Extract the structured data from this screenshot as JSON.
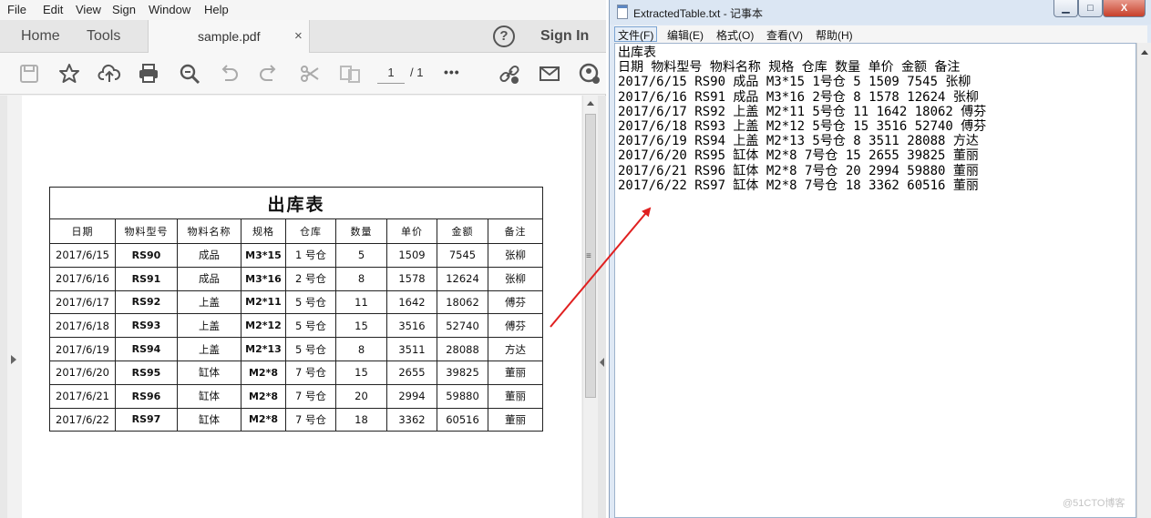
{
  "pdf_viewer": {
    "menu": [
      "File",
      "Edit",
      "View",
      "Sign",
      "Window",
      "Help"
    ],
    "tabs": {
      "home": "Home",
      "tools": "Tools"
    },
    "document_tab": {
      "name": "sample.pdf",
      "close": "×"
    },
    "help": "?",
    "sign_in": "Sign In",
    "toolbar": {
      "icons": [
        "save-icon",
        "star-icon",
        "upload-icon",
        "print-icon",
        "zoom-icon",
        "undo-icon",
        "redo-icon",
        "scissors-icon",
        "compare-icon",
        "more-icon",
        "share-link-icon",
        "mail-icon",
        "add-user-icon"
      ],
      "page_current": "1",
      "page_total": "/ 1",
      "more": "•••"
    },
    "table": {
      "title": "出库表",
      "headers": [
        "日期",
        "物料型号",
        "物料名称",
        "规格",
        "仓库",
        "数量",
        "单价",
        "金额",
        "备注"
      ],
      "rows": [
        [
          "2017/6/15",
          "RS90",
          "成品",
          "M3*15",
          "1 号仓",
          "5",
          "1509",
          "7545",
          "张柳"
        ],
        [
          "2017/6/16",
          "RS91",
          "成品",
          "M3*16",
          "2 号仓",
          "8",
          "1578",
          "12624",
          "张柳"
        ],
        [
          "2017/6/17",
          "RS92",
          "上盖",
          "M2*11",
          "5 号仓",
          "11",
          "1642",
          "18062",
          "傅芬"
        ],
        [
          "2017/6/18",
          "RS93",
          "上盖",
          "M2*12",
          "5 号仓",
          "15",
          "3516",
          "52740",
          "傅芬"
        ],
        [
          "2017/6/19",
          "RS94",
          "上盖",
          "M2*13",
          "5 号仓",
          "8",
          "3511",
          "28088",
          "方达"
        ],
        [
          "2017/6/20",
          "RS95",
          "缸体",
          "M2*8",
          "7 号仓",
          "15",
          "2655",
          "39825",
          "董丽"
        ],
        [
          "2017/6/21",
          "RS96",
          "缸体",
          "M2*8",
          "7 号仓",
          "20",
          "2994",
          "59880",
          "董丽"
        ],
        [
          "2017/6/22",
          "RS97",
          "缸体",
          "M2*8",
          "7 号仓",
          "18",
          "3362",
          "60516",
          "董丽"
        ]
      ]
    }
  },
  "notepad": {
    "title": "ExtractedTable.txt - 记事本",
    "window_buttons": {
      "minimize": "▁",
      "maximize": "□",
      "close": "X"
    },
    "menu": [
      "文件(F)",
      "编辑(E)",
      "格式(O)",
      "查看(V)",
      "帮助(H)"
    ],
    "lines": [
      "出库表",
      "日期 物料型号 物料名称 规格 仓库 数量 单价 金额 备注",
      "2017/6/15 RS90 成品 M3*15 1号仓 5 1509 7545 张柳",
      "2017/6/16 RS91 成品 M3*16 2号仓 8 1578 12624 张柳",
      "2017/6/17 RS92 上盖 M2*11 5号仓 11 1642 18062 傅芬",
      "2017/6/18 RS93 上盖 M2*12 5号仓 15 3516 52740 傅芬",
      "2017/6/19 RS94 上盖 M2*13 5号仓 8 3511 28088 方达",
      "2017/6/20 RS95 缸体 M2*8 7号仓 15 2655 39825 董丽",
      "2017/6/21 RS96 缸体 M2*8 7号仓 20 2994 59880 董丽",
      "2017/6/22 RS97 缸体 M2*8 7号仓 18 3362 60516 董丽"
    ]
  },
  "watermark": "@51CTO博客",
  "colors": {
    "arrow": "#e02020"
  }
}
